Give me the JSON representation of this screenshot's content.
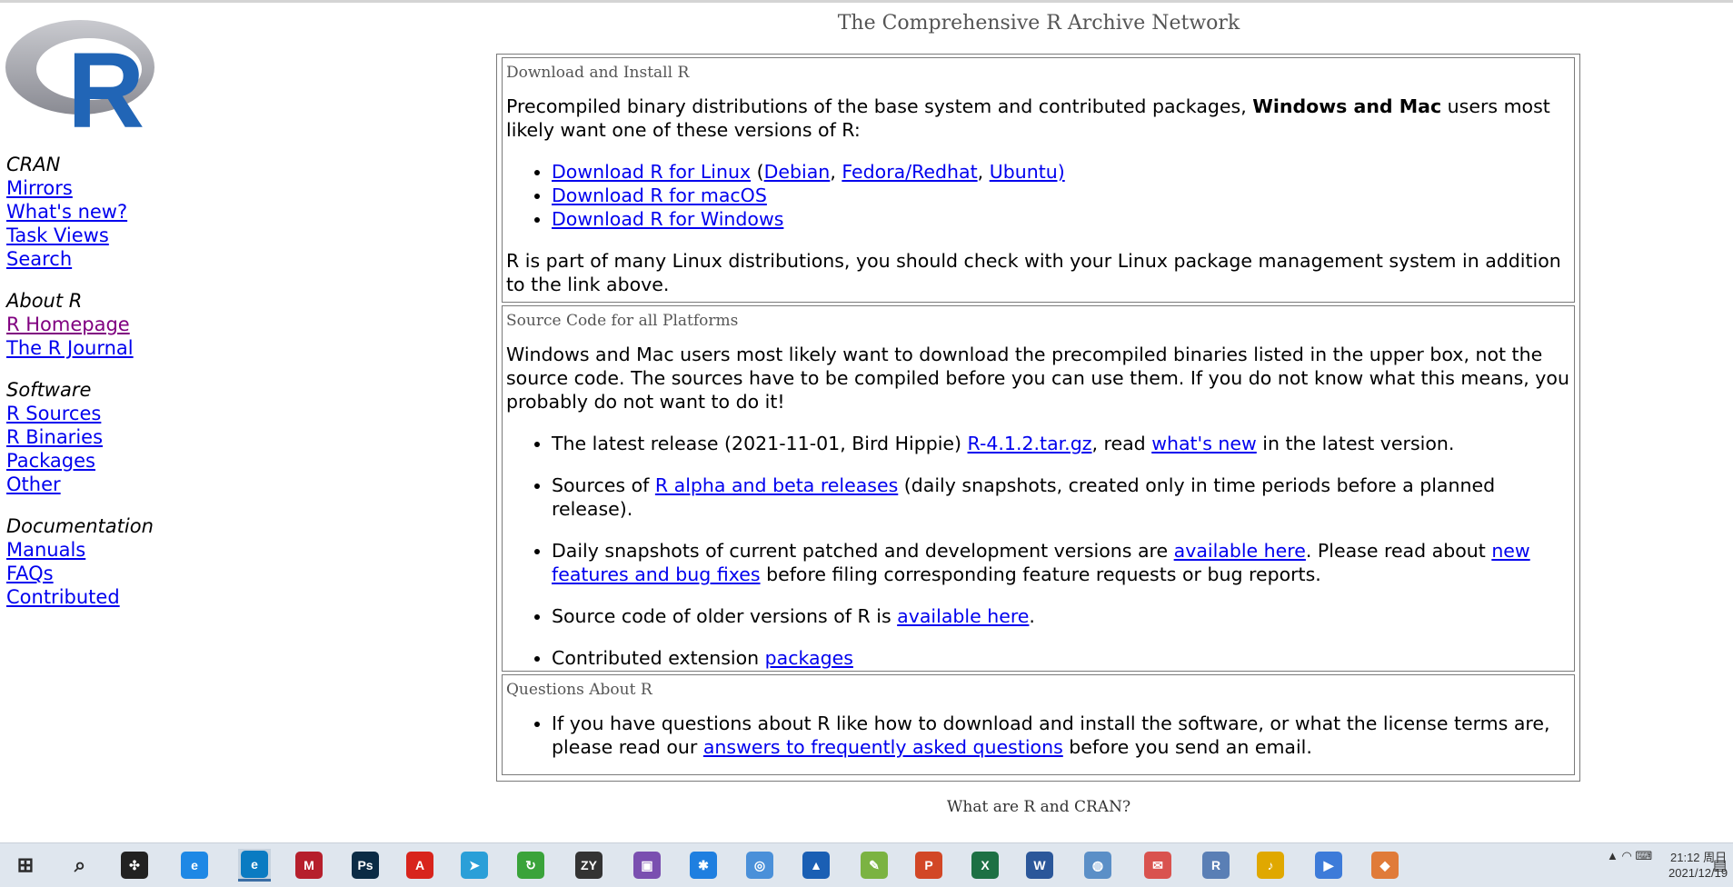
{
  "page_title": "The Comprehensive R Archive Network",
  "sidebar": {
    "groups": [
      {
        "heading": "CRAN",
        "links": [
          "Mirrors",
          "What's new?",
          "Task Views",
          "Search"
        ]
      },
      {
        "heading": "About R",
        "links": [
          "R Homepage",
          "The R Journal"
        ]
      },
      {
        "heading": "Software",
        "links": [
          "R Sources",
          "R Binaries",
          "Packages",
          "Other"
        ]
      },
      {
        "heading": "Documentation",
        "links": [
          "Manuals",
          "FAQs",
          "Contributed"
        ]
      }
    ]
  },
  "download_panel": {
    "title": "Download and Install R",
    "intro_before": "Precompiled binary distributions of the base system and contributed packages, ",
    "intro_bold": "Windows and Mac",
    "intro_after": " users most likely want one of these versions of R:",
    "linux_link": "Download R for Linux",
    "linux_open": " (",
    "debian": "Debian",
    "comma1": ", ",
    "fedora": "Fedora/Redhat",
    "comma2": ", ",
    "ubuntu": "Ubuntu)",
    "macos_link": "Download R for macOS",
    "windows_link": "Download R for Windows",
    "note": "R is part of many Linux distributions, you should check with your Linux package management system in addition to the link above."
  },
  "source_panel": {
    "title": "Source Code for all Platforms",
    "intro": "Windows and Mac users most likely want to download the precompiled binaries listed in the upper box, not the source code. The sources have to be compiled before you can use them. If you do not know what this means, you probably do not want to do it!",
    "item1_a": "The latest release (2021-11-01, Bird Hippie) ",
    "item1_link1": "R-4.1.2.tar.gz",
    "item1_b": ", read ",
    "item1_link2": "what's new",
    "item1_c": " in the latest version.",
    "item2_a": "Sources of ",
    "item2_link": "R alpha and beta releases",
    "item2_b": " (daily snapshots, created only in time periods before a planned release).",
    "item3_a": "Daily snapshots of current patched and development versions are ",
    "item3_link1": "available here",
    "item3_b": ". Please read about ",
    "item3_link2": "new features and bug fixes",
    "item3_c": " before filing corresponding feature requests or bug reports.",
    "item4_a": "Source code of older versions of R is ",
    "item4_link": "available here",
    "item4_b": ".",
    "item5_a": "Contributed extension ",
    "item5_link": "packages"
  },
  "questions_panel": {
    "title": "Questions About R",
    "item_a": "If you have questions about R like how to download and install the software, or what the license terms are, please read our ",
    "item_link": "answers to frequently asked questions",
    "item_b": " before you send an email."
  },
  "bottom_heading": "What are R and CRAN?",
  "logo_letter": "R",
  "taskbar": {
    "icons": [
      {
        "name": "windows-start-icon",
        "glyph": "⊞",
        "color": "#2b2b2b"
      },
      {
        "name": "search-icon",
        "glyph": "⌕",
        "color": "#2b2b2b"
      },
      {
        "name": "pinwheel-app-icon",
        "glyph": "✣",
        "color": "#222222"
      },
      {
        "name": "internet-explorer-icon",
        "glyph": "e",
        "color": "#1e88e5"
      },
      {
        "name": "edge-browser-icon",
        "glyph": "e",
        "color": "#0a7bc2"
      },
      {
        "name": "mendeley-icon",
        "glyph": "M",
        "color": "#b61f2c"
      },
      {
        "name": "photoshop-icon",
        "glyph": "Ps",
        "color": "#0b2b45"
      },
      {
        "name": "acrobat-icon",
        "glyph": "A",
        "color": "#d8241c"
      },
      {
        "name": "telegram-icon",
        "glyph": "➤",
        "color": "#2a9fd8"
      },
      {
        "name": "update-icon",
        "glyph": "↻",
        "color": "#3aa33a"
      },
      {
        "name": "zotero-icon",
        "glyph": "ZY",
        "color": "#333333"
      },
      {
        "name": "photo-viewer-icon",
        "glyph": "▣",
        "color": "#7a4fb0"
      },
      {
        "name": "assistant-icon",
        "glyph": "✱",
        "color": "#1f7fe0"
      },
      {
        "name": "network-app-icon",
        "glyph": "◎",
        "color": "#4a90d9"
      },
      {
        "name": "pointer-app-icon",
        "glyph": "▲",
        "color": "#1a5fb4"
      },
      {
        "name": "notes-app-icon",
        "glyph": "✎",
        "color": "#7bb342"
      },
      {
        "name": "powerpoint-icon",
        "glyph": "P",
        "color": "#d24726"
      },
      {
        "name": "excel-icon",
        "glyph": "X",
        "color": "#1d7044"
      },
      {
        "name": "word-icon",
        "glyph": "W",
        "color": "#2b579a"
      },
      {
        "name": "globe-app-icon",
        "glyph": "◍",
        "color": "#5b8fc7"
      },
      {
        "name": "mail-app-icon",
        "glyph": "✉",
        "color": "#d9534f"
      },
      {
        "name": "r-app-icon",
        "glyph": "R",
        "color": "#5a7fb5"
      },
      {
        "name": "media-app-icon",
        "glyph": "♪",
        "color": "#e0a800"
      },
      {
        "name": "video-app-icon",
        "glyph": "▶",
        "color": "#3d7bd9"
      },
      {
        "name": "bag-app-icon",
        "glyph": "◆",
        "color": "#e07b39"
      }
    ],
    "clock_time": "21:12 周日",
    "clock_date": "2021/12/19"
  }
}
